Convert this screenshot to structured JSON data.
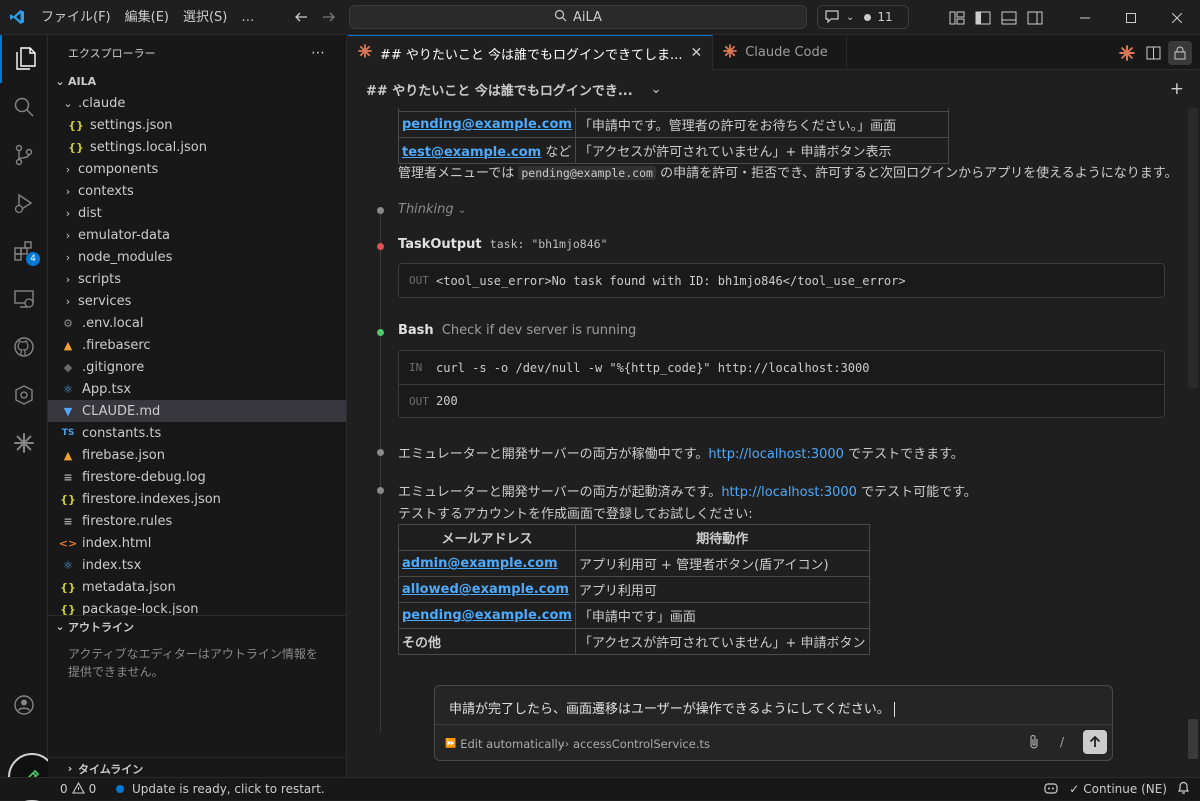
{
  "titlebar": {
    "menus": [
      "ファイル(F)",
      "編集(E)",
      "選択(S)",
      "…"
    ],
    "search": "AiLA",
    "copilot_count": "11"
  },
  "activity_badge": "4",
  "explorer": {
    "header": "エクスプローラー",
    "root": "AILA",
    "items": [
      {
        "name": ".claude",
        "type": "folder-open",
        "depth": 1
      },
      {
        "name": "settings.json",
        "type": "json",
        "depth": 2
      },
      {
        "name": "settings.local.json",
        "type": "json",
        "depth": 2
      },
      {
        "name": "components",
        "type": "folder",
        "depth": 1
      },
      {
        "name": "contexts",
        "type": "folder",
        "depth": 1
      },
      {
        "name": "dist",
        "type": "folder",
        "depth": 1
      },
      {
        "name": "emulator-data",
        "type": "folder",
        "depth": 1
      },
      {
        "name": "node_modules",
        "type": "folder",
        "depth": 1
      },
      {
        "name": "scripts",
        "type": "folder",
        "depth": 1
      },
      {
        "name": "services",
        "type": "folder",
        "depth": 1
      },
      {
        "name": ".env.local",
        "type": "gear",
        "depth": 1
      },
      {
        "name": ".firebaserc",
        "type": "firebase",
        "depth": 1
      },
      {
        "name": ".gitignore",
        "type": "git",
        "depth": 1
      },
      {
        "name": "App.tsx",
        "type": "react",
        "depth": 1
      },
      {
        "name": "CLAUDE.md",
        "type": "md",
        "depth": 1,
        "selected": true
      },
      {
        "name": "constants.ts",
        "type": "ts",
        "depth": 1
      },
      {
        "name": "firebase.json",
        "type": "firebase",
        "depth": 1
      },
      {
        "name": "firestore-debug.log",
        "type": "lines",
        "depth": 1
      },
      {
        "name": "firestore.indexes.json",
        "type": "json",
        "depth": 1
      },
      {
        "name": "firestore.rules",
        "type": "lines",
        "depth": 1
      },
      {
        "name": "index.html",
        "type": "html",
        "depth": 1
      },
      {
        "name": "index.tsx",
        "type": "react",
        "depth": 1
      },
      {
        "name": "metadata.json",
        "type": "json",
        "depth": 1
      },
      {
        "name": "package-lock.json",
        "type": "json",
        "depth": 1
      }
    ],
    "outline_title": "アウトライン",
    "outline_msg": "アクティブなエディターはアウトライン情報を提供できません。",
    "timeline_title": "タイムライン"
  },
  "tabs": [
    {
      "label": "## やりたいこと 今は誰でもログインできてしま...",
      "active": true
    },
    {
      "label": "Claude Code",
      "active": false
    }
  ],
  "subheader": "## やりたいこと 今は誰でもログインでき...",
  "chat": {
    "top_table": [
      {
        "email": "pending@example.com",
        "desc": "「申請中です。管理者の許可をお待ちください。」画面"
      },
      {
        "email": "test@example.com",
        "suffix": "など",
        "desc": "「アクセスが許可されていません」+ 申請ボタン表示"
      }
    ],
    "admin_note_pre": "管理者メニューでは",
    "admin_note_code": "pending@example.com",
    "admin_note_post": "の申請を許可・拒否でき、許可すると次回ログインからアプリを使えるようになります。",
    "thinking": "Thinking",
    "taskoutput": {
      "title": "TaskOutput",
      "arg": "task: \"bh1mjo846\"",
      "out_label": "OUT",
      "out": "<tool_use_error>No task found with ID: bh1mjo846</tool_use_error>"
    },
    "bash": {
      "title": "Bash",
      "desc": "Check if dev server is running",
      "in_label": "IN",
      "in": "curl -s -o /dev/null -w \"%{http_code}\" http://localhost:3000",
      "out_label": "OUT",
      "out": "200"
    },
    "msg1_pre": "エミュレーターと開発サーバーの両方が稼働中です。",
    "msg1_link": "http://localhost:3000",
    "msg1_post": "でテストできます。",
    "msg2_pre": "エミュレーターと開発サーバーの両方が起動済みです。",
    "msg2_link": "http://localhost:3000",
    "msg2_post": "でテスト可能です。",
    "msg2_line2": "テストするアカウントを作成画面で登録してお試しください:",
    "table_headers": [
      "メールアドレス",
      "期待動作"
    ],
    "table_rows": [
      {
        "email": "admin@example.com",
        "desc": "アプリ利用可 + 管理者ボタン(盾アイコン)"
      },
      {
        "email": "allowed@example.com",
        "desc": "アプリ利用可"
      },
      {
        "email": "pending@example.com",
        "desc": "「申請中です」画面"
      },
      {
        "email": "その他",
        "desc": "「アクセスが許可されていません」+ 申請ボタン"
      }
    ],
    "input_text": "申請が完了したら、画面遷移はユーザーが操作できるようにしてください。",
    "edit_mode": "Edit automatically",
    "context_file": "accessControlService.ts"
  },
  "statusbar": {
    "errors": "0",
    "warnings": "0",
    "update": "Update is ready, click to restart.",
    "continue": "Continue (NE)"
  },
  "colors": {
    "accent": "#0078d4",
    "link": "#4daafc",
    "claude": "#d97757",
    "success": "#4ec96b",
    "error": "#e05252"
  }
}
